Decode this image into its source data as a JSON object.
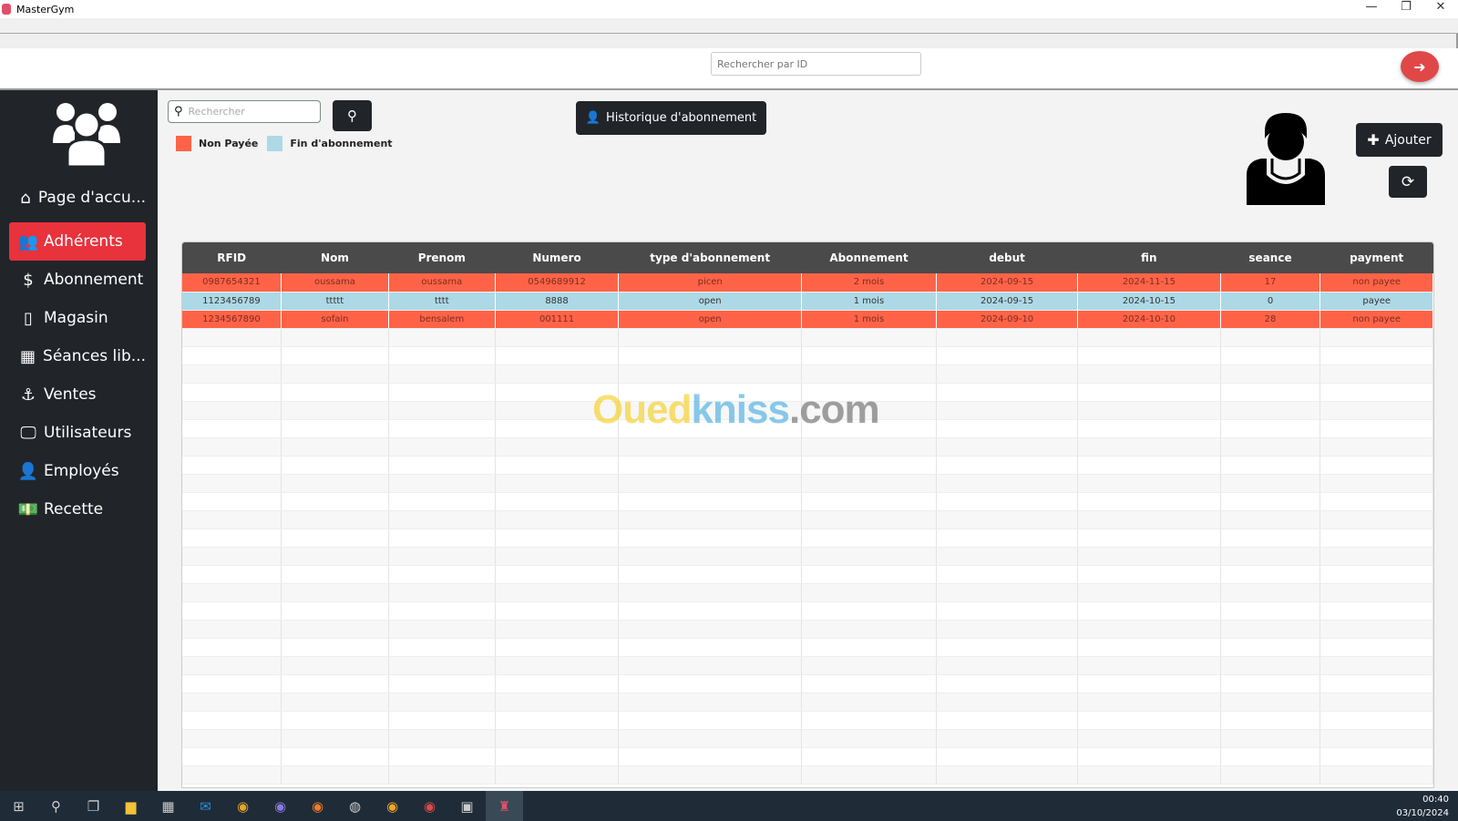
{
  "window": {
    "title": "MasterGym",
    "controls": [
      "—",
      "❐",
      "✕"
    ]
  },
  "header": {
    "id_search_placeholder": "Rechercher par ID",
    "logout_icon": "sign-out-icon"
  },
  "sidebar": {
    "items": [
      {
        "label": "Page d'accu...",
        "icon": "⌂",
        "active": false
      },
      {
        "label": "Adhérents",
        "icon": "👥",
        "active": true
      },
      {
        "label": "Abonnement",
        "icon": "$",
        "active": false
      },
      {
        "label": "Magasin",
        "icon": "▯",
        "active": false
      },
      {
        "label": "Séances lib...",
        "icon": "▦",
        "active": false
      },
      {
        "label": "Ventes",
        "icon": "⚓",
        "active": false
      },
      {
        "label": "Utilisateurs",
        "icon": "🖵",
        "active": false
      },
      {
        "label": "Employés",
        "icon": "👤",
        "active": false
      },
      {
        "label": "Recette",
        "icon": "💵",
        "active": false
      }
    ]
  },
  "main": {
    "search_placeholder": "Rechercher",
    "history_button": "Historique d'abonnement",
    "add_button": "Ajouter",
    "legend": [
      {
        "label": "Non Payée",
        "color": "#ff6347"
      },
      {
        "label": "Fin d'abonnement",
        "color": "#add8e6"
      }
    ],
    "table": {
      "columns": [
        "RFID",
        "Nom",
        "Prenom",
        "Numero",
        "type d'abonnement",
        "Abonnement",
        "debut",
        "fin",
        "seance",
        "payment"
      ],
      "rows": [
        {
          "status": "red",
          "cells": [
            "0987654321",
            "oussama",
            "oussama",
            "0549689912",
            "picen",
            "2 mois",
            "2024-09-15",
            "2024-11-15",
            "17",
            "non payee"
          ]
        },
        {
          "status": "blue",
          "cells": [
            "1123456789",
            "ttttt",
            "tttt",
            "8888",
            "open",
            "1 mois",
            "2024-09-15",
            "2024-10-15",
            "0",
            "payee"
          ]
        },
        {
          "status": "red",
          "cells": [
            "1234567890",
            "sofain",
            "bensalem",
            "001111",
            "open",
            "1 mois",
            "2024-09-10",
            "2024-10-10",
            "28",
            "non payee"
          ]
        }
      ]
    }
  },
  "watermark": {
    "part1": "Oued",
    "part2": "kniss",
    "part3": ".com"
  },
  "taskbar": {
    "time": "00:40",
    "date": "03/10/2024"
  }
}
